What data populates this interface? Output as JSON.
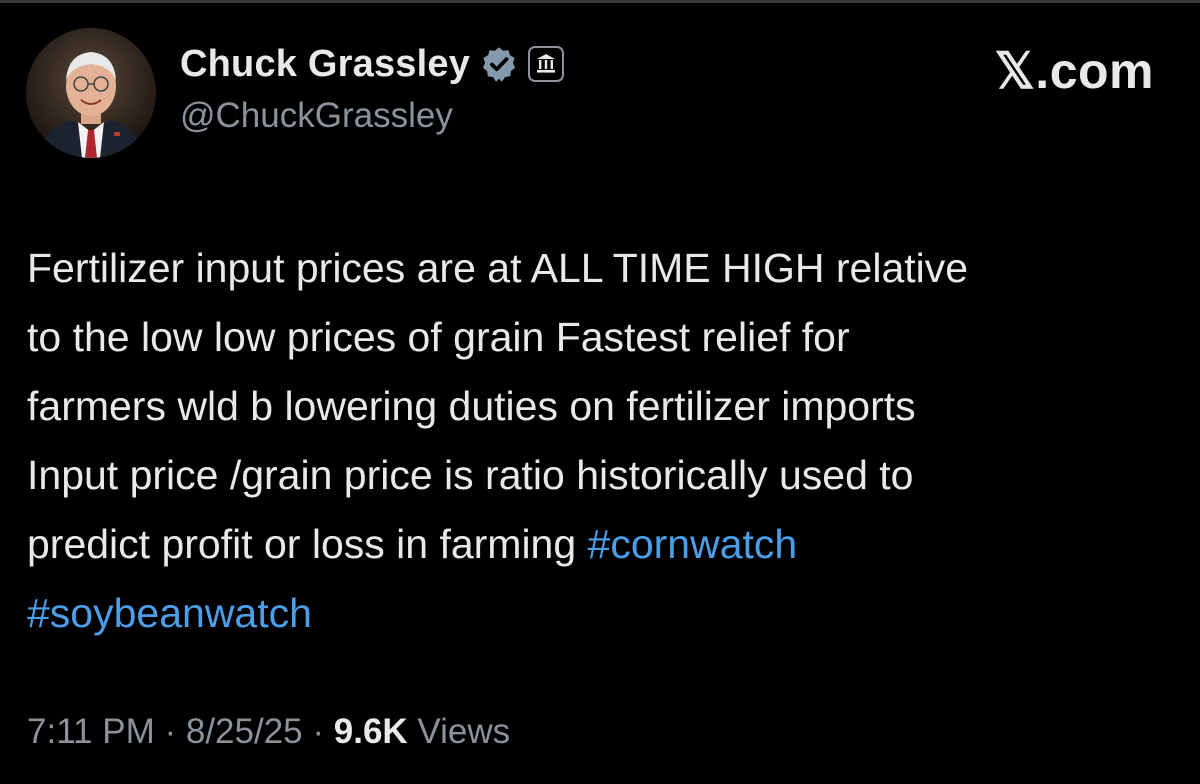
{
  "site": {
    "label": "𝕏.com"
  },
  "author": {
    "name": "Chuck Grassley",
    "handle": "@ChuckGrassley",
    "verified_icon": "verified-badge-icon",
    "affiliation_icon": "government-building-icon"
  },
  "tweet": {
    "lines": [
      "Fertilizer input prices are at ALL TIME HIGH relative",
      "to the low low prices of grain Fastest relief for",
      "farmers wld b lowering duties on fertilizer imports",
      "Input price /grain price is ratio historically used to",
      "predict profit or loss in farming "
    ],
    "hashtags": [
      "#cornwatch",
      "#soybeanwatch"
    ]
  },
  "meta": {
    "time": "7:11 PM",
    "separator": " · ",
    "date": "8/25/25",
    "views_count": "9.6K",
    "views_label": " Views"
  },
  "colors": {
    "background": "#000000",
    "text": "#e7e9ea",
    "muted": "#8b9299",
    "hashtag": "#4c9ee8"
  }
}
